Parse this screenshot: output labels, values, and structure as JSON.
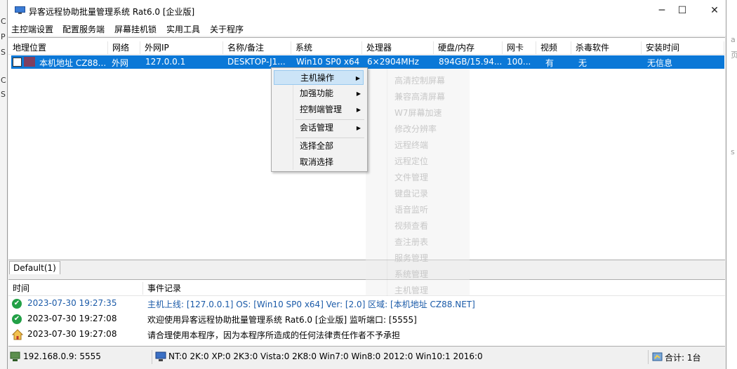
{
  "window": {
    "title": "异客远程协助批量管理系统 Rat6.0  [企业版]",
    "controls": {
      "minimize": "─",
      "maximize": "☐",
      "close": "✕"
    }
  },
  "menu": [
    "主控端设置",
    "配置服务端",
    "屏幕挂机锁",
    "实用工具",
    "关于程序"
  ],
  "table": {
    "columns": [
      "地理位置",
      "网络",
      "外网IP",
      "名称/备注",
      "系统",
      "处理器",
      "硬盘/内存",
      "网卡",
      "视频",
      "杀毒软件",
      "安装时间"
    ],
    "rows": [
      [
        "本机地址  CZ88...",
        "外网",
        "127.0.0.1",
        "DESKTOP-J1...",
        "Win10 SP0 x64",
        "6×2904MHz",
        "894GB/15.94...",
        "100...",
        "有",
        "无",
        "无信息"
      ]
    ]
  },
  "group_tab": "Default(1)",
  "context_menu": {
    "items": [
      {
        "label": "主机操作",
        "submenu": true,
        "highlighted": true
      },
      {
        "label": "加强功能",
        "submenu": true
      },
      {
        "label": "控制端管理",
        "submenu": true
      },
      {
        "label": "会话管理",
        "submenu": true
      },
      {
        "label": "选择全部",
        "submenu": false
      },
      {
        "label": "取消选择",
        "submenu": false
      }
    ],
    "arrow": "▶"
  },
  "submenu_items": [
    "高清控制屏幕",
    "兼容高清屏幕",
    "W7屏幕加速",
    "修改分辨率",
    "远程终端",
    "远程定位",
    "文件管理",
    "键盘记录",
    "语音监听",
    "视频查看",
    "查注册表",
    "服务管理",
    "系统管理",
    "主机管理"
  ],
  "log": {
    "columns": [
      "时间",
      "事件记录"
    ],
    "rows": [
      {
        "time": "2023-07-30 19:27:35",
        "message": "主机上线: [127.0.0.1]   OS: [Win10 SP0 x64]   Ver: [2.0]   区域: [本机地址  CZ88.NET]",
        "icon": "check-icon",
        "highlight": true
      },
      {
        "time": "2023-07-30 19:27:08",
        "message": "欢迎使用异客远程协助批量管理系统 Rat6.0  [企业版]   监听端口: [5555]",
        "icon": "check-icon",
        "highlight": false
      },
      {
        "time": "2023-07-30 19:27:08",
        "message": "请合理使用本程序，因为本程序所造成的任何法律责任作者不予承担",
        "icon": "home-warning-icon",
        "highlight": false
      }
    ]
  },
  "status": {
    "listen": "192.168.0.9: 5555",
    "os_counts": "NT:0   2K:0   XP:0   2K3:0   Vista:0   2K8:0   Win7:0   Win8:0   2012:0   Win10:1   2016:0",
    "total": "合计: 1台"
  },
  "background": {
    "left_letters": [
      "C",
      "P",
      "S",
      "C",
      "S"
    ],
    "right_chars": [
      "a",
      "页",
      "s"
    ]
  },
  "colors": {
    "selection": "#0b78d7",
    "accent": "#1a5aa8",
    "success": "#22a046"
  }
}
